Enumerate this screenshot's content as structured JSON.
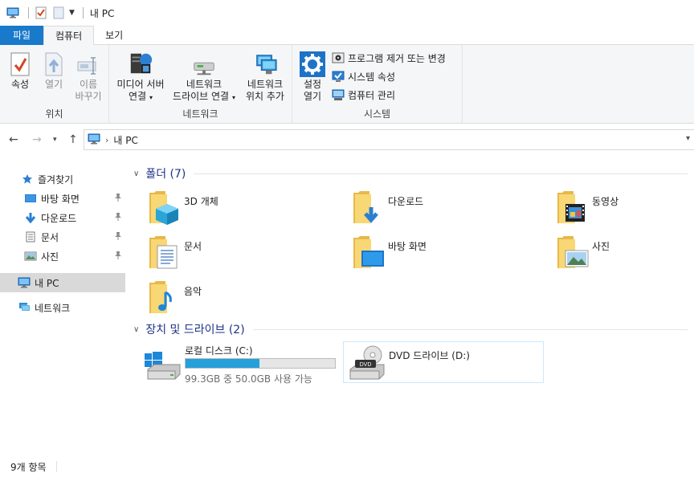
{
  "window": {
    "title": "내 PC"
  },
  "ribbon": {
    "tabs": [
      {
        "label": "파일"
      },
      {
        "label": "컴퓨터"
      },
      {
        "label": "보기"
      }
    ],
    "location_group": {
      "label": "위치",
      "properties": "속성",
      "open": "열기",
      "rename_line1": "이름",
      "rename_line2": "바꾸기"
    },
    "network_group": {
      "label": "네트워크",
      "media_line1": "미디어 서버",
      "media_line2": "연결",
      "map_line1": "네트워크",
      "map_line2": "드라이브 연결",
      "add_line1": "네트워크",
      "add_line2": "위치 추가"
    },
    "system_group": {
      "label": "시스템",
      "settings_line1": "설정",
      "settings_line2": "열기",
      "uninstall": "프로그램 제거 또는 변경",
      "system_props": "시스템 속성",
      "manage": "컴퓨터 관리"
    }
  },
  "address": {
    "crumb": "내 PC"
  },
  "nav_pane": {
    "quick_access": "즐겨찾기",
    "desktop": "바탕 화면",
    "downloads": "다운로드",
    "documents": "문서",
    "pictures": "사진",
    "this_pc": "내 PC",
    "network": "네트워크"
  },
  "content": {
    "folders_header": "폴더 (7)",
    "folders": [
      {
        "name": "3D 개체"
      },
      {
        "name": "다운로드"
      },
      {
        "name": "동영상"
      },
      {
        "name": "문서"
      },
      {
        "name": "바탕 화면"
      },
      {
        "name": "사진"
      },
      {
        "name": "음악"
      }
    ],
    "devices_header": "장치 및 드라이브 (2)",
    "drives": [
      {
        "name": "로컬 디스크 (C:)",
        "free_text": "99.3GB 중 50.0GB 사용 가능",
        "used_fraction": 0.497
      },
      {
        "name": "DVD 드라이브 (D:)"
      }
    ]
  },
  "status": {
    "item_count": "9개 항목"
  },
  "colors": {
    "accent": "#1979ca",
    "drive_bar": "#26a0da",
    "header_text": "#1e3287",
    "folder_yellow": "#f8d775"
  }
}
